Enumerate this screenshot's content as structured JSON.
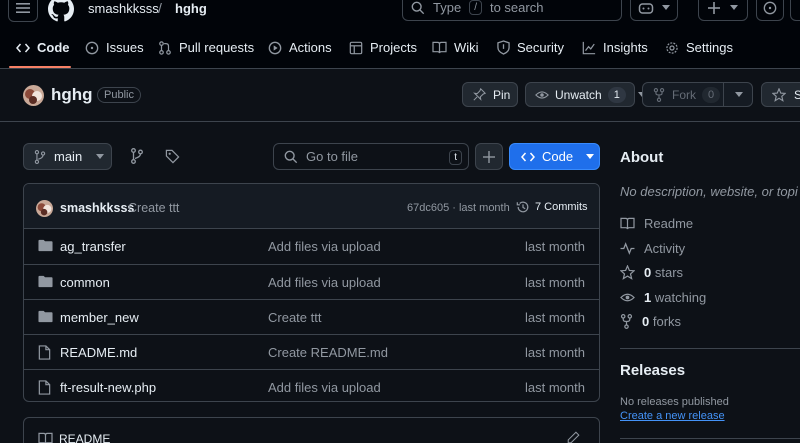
{
  "header": {
    "owner": "smashkksss",
    "separator": "/",
    "repo": "hghg",
    "search_placeholder": "Type",
    "search_kbd": "/",
    "search_suffix": "to search"
  },
  "nav": {
    "tabs": [
      {
        "label": "Code",
        "icon": "code-icon"
      },
      {
        "label": "Issues",
        "icon": "issue-icon"
      },
      {
        "label": "Pull requests",
        "icon": "pull-request-icon"
      },
      {
        "label": "Actions",
        "icon": "play-icon"
      },
      {
        "label": "Projects",
        "icon": "table-icon"
      },
      {
        "label": "Wiki",
        "icon": "book-icon"
      },
      {
        "label": "Security",
        "icon": "shield-icon"
      },
      {
        "label": "Insights",
        "icon": "graph-icon"
      },
      {
        "label": "Settings",
        "icon": "gear-icon"
      }
    ],
    "active_tab": "Code"
  },
  "repo": {
    "name": "hghg",
    "visibility": "Public",
    "pin_label": "Pin",
    "unwatch_label": "Unwatch",
    "watch_count": "1",
    "fork_label": "Fork",
    "fork_count": "0",
    "star_label": "S"
  },
  "toolbar": {
    "branch": "main",
    "goto_placeholder": "Go to file",
    "goto_kbd": "t",
    "code_label": "Code"
  },
  "latest_commit": {
    "author": "smashkksss",
    "message": "Create ttt",
    "hash_time": "67dc605 · last month",
    "commits_label": "7 Commits"
  },
  "files": [
    {
      "type": "folder",
      "name": "ag_transfer",
      "message": "Add files via upload",
      "time": "last month"
    },
    {
      "type": "folder",
      "name": "common",
      "message": "Add files via upload",
      "time": "last month"
    },
    {
      "type": "folder",
      "name": "member_new",
      "message": "Create ttt",
      "time": "last month"
    },
    {
      "type": "file",
      "name": "README.md",
      "message": "Create README.md",
      "time": "last month"
    },
    {
      "type": "file",
      "name": "ft-result-new.php",
      "message": "Add files via upload",
      "time": "last month"
    }
  ],
  "readme": {
    "label": "README"
  },
  "about": {
    "title": "About",
    "description": "No description, website, or topi",
    "readme_label": "Readme",
    "activity_label": "Activity",
    "stars_count": "0",
    "stars_label": "stars",
    "watching_count": "1",
    "watching_label": "watching",
    "forks_count": "0",
    "forks_label": "forks"
  },
  "releases": {
    "title": "Releases",
    "none_text": "No releases published",
    "create_link": "Create a new release"
  },
  "colors": {
    "background": "#0d1117",
    "accent_blue": "#1f6feb",
    "tab_underline": "#f78166",
    "link": "#4493f8"
  }
}
